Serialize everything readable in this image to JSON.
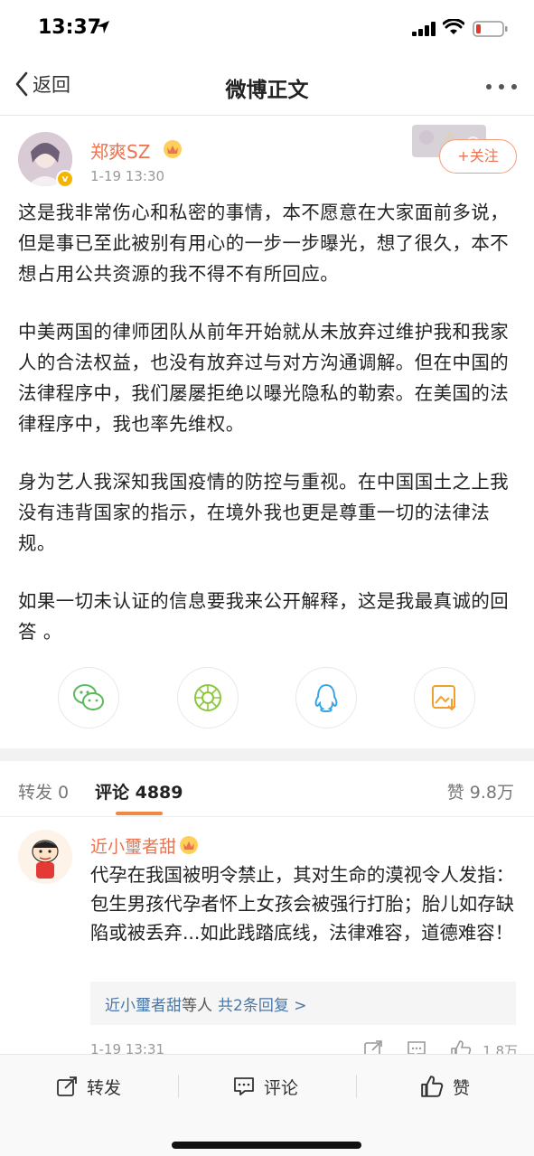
{
  "status_bar": {
    "time": "13:37"
  },
  "nav": {
    "back_label": "返回",
    "title": "微博正文"
  },
  "author": {
    "name": "郑爽SZ",
    "date": "1-19 13:30",
    "follow_label": "+关注"
  },
  "post": {
    "paragraphs": [
      "这是我非常伤心和私密的事情，本不愿意在大家面前多说，但是事已至此被别有用心的一步一步曝光，想了很久，本不想占用公共资源的我不得不有所回应。",
      "中美两国的律师团队从前年开始就从未放弃过维护我和我家人的合法权益，也没有放弃过与对方沟通调解。但在中国的法律程序中，我们屡屡拒绝以曝光隐私的勒索。在美国的法律程序中，我也率先维权。",
      "身为艺人我深知我国疫情的防控与重视。在中国国土之上我没有违背国家的指示，在境外我也更是尊重一切的法律法规。",
      "如果一切未认证的信息要我来公开解释，这是我最真诚的回答 。"
    ]
  },
  "tabs": {
    "repost": "转发 0",
    "comments": "评论 4889",
    "likes": "赞 9.8万"
  },
  "comment": {
    "name": "近小璽者甜",
    "text": "代孕在我国被明令禁止，其对生命的漠视令人发指：包生男孩代孕者怀上女孩会被强行打胎；胎儿如存缺陷或被丢弃...如此践踏底线，法律难容，道德难容！",
    "replies_name": "近小璽者甜",
    "replies_suffix": "等人",
    "replies_count": "共2条回复 >",
    "date": "1-19 13:31",
    "likes": "1.8万"
  },
  "bottom_bar": {
    "repost": "转发",
    "comment": "评论",
    "like": "赞"
  },
  "colors": {
    "accent": "#eb7350",
    "link": "#4a76a8",
    "tab_underline": "#f08843"
  },
  "icons": [
    "location-arrow-icon",
    "signal-icon",
    "wifi-icon",
    "battery-icon",
    "back-chevron-icon",
    "more-dots-icon",
    "wechat-icon",
    "moments-icon",
    "qq-icon",
    "save-image-icon",
    "share-icon",
    "comment-icon",
    "like-icon"
  ]
}
